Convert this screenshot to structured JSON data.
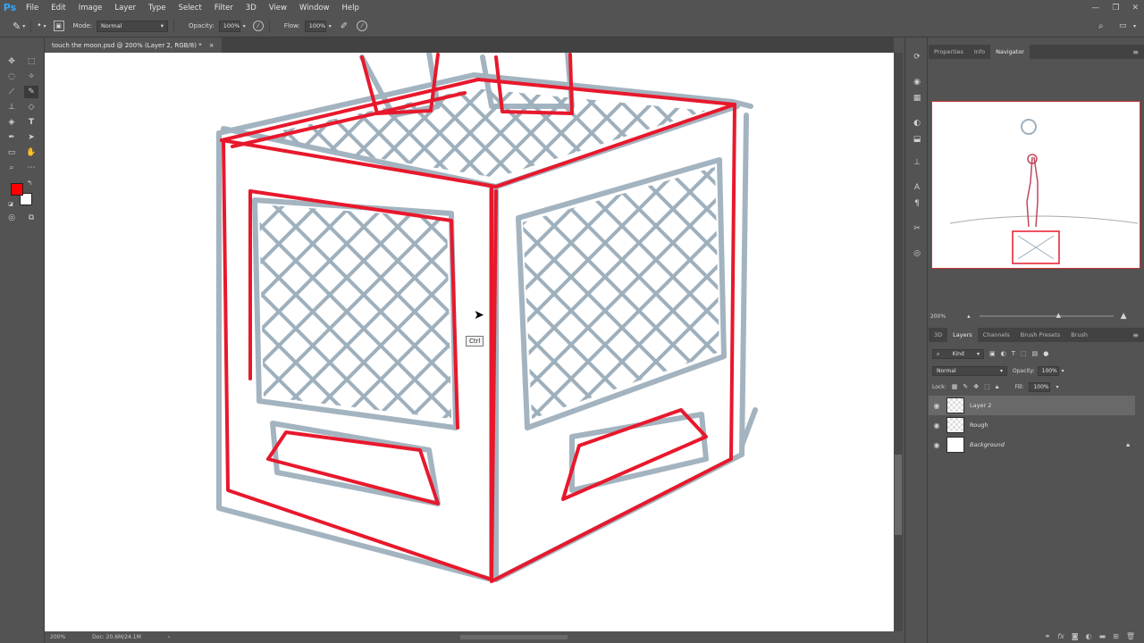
{
  "app": {
    "logo": "Ps",
    "menu": [
      "File",
      "Edit",
      "Image",
      "Layer",
      "Type",
      "Select",
      "Filter",
      "3D",
      "View",
      "Window",
      "Help"
    ],
    "window_controls": [
      "—",
      "❐",
      "✕"
    ]
  },
  "options_bar": {
    "mode_label": "Mode:",
    "mode_value": "Normal",
    "opacity_label": "Opacity:",
    "opacity_value": "100%",
    "flow_label": "Flow:",
    "flow_value": "100%"
  },
  "document": {
    "tab_title": "touch the moon.psd @ 200% (Layer 2, RGB/8) *",
    "tab_close": "×",
    "tooltip": "Ctrl"
  },
  "status_bar": {
    "zoom": "200%",
    "doc_size": "Doc: 20.6M/24.1M"
  },
  "colors": {
    "foreground": "#ff0000",
    "background": "#ffffff",
    "sketch_red": "#e8182c",
    "sketch_blue": "#9fb0bd"
  },
  "top_panel": {
    "tabs": [
      "Properties",
      "Info",
      "Navigator"
    ],
    "active_tab": "Navigator",
    "zoom": "200%"
  },
  "layers_panel": {
    "tabs": [
      "3D",
      "Layers",
      "Channels",
      "Brush Presets",
      "Brush"
    ],
    "active_tab": "Layers",
    "filter_kind": "Kind",
    "blend_mode": "Normal",
    "opacity_label": "Opacity:",
    "opacity_value": "100%",
    "lock_label": "Lock:",
    "fill_label": "Fill:",
    "fill_value": "100%",
    "layers": [
      {
        "name": "Layer 2",
        "selected": true
      },
      {
        "name": "Rough",
        "selected": false
      },
      {
        "name": "Background",
        "selected": false
      }
    ]
  }
}
